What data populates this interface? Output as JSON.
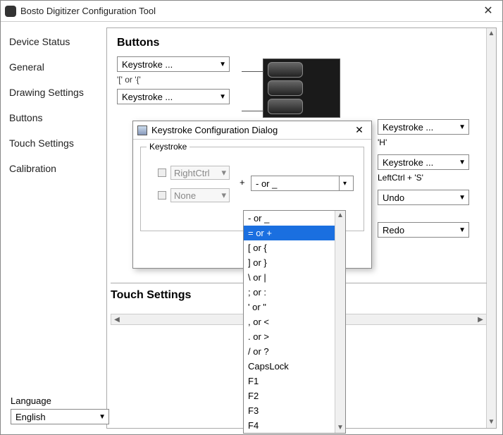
{
  "window": {
    "title": "Bosto Digitizer Configuration Tool"
  },
  "sidebar": {
    "items": [
      {
        "label": "Device Status"
      },
      {
        "label": "General"
      },
      {
        "label": "Drawing Settings"
      },
      {
        "label": "Buttons"
      },
      {
        "label": "Touch Settings"
      },
      {
        "label": "Calibration"
      }
    ]
  },
  "buttons_section": {
    "title": "Buttons",
    "combo1": "Keystroke ...",
    "caption1": "'[' or '{'",
    "combo2": "Keystroke ..."
  },
  "right_col": {
    "c1": "Keystroke ...",
    "c1_caption": "'H'",
    "c2": "Keystroke ...",
    "c2_caption": "LeftCtrl + 'S'",
    "c3": "Undo",
    "c4": "Redo"
  },
  "touch_section": {
    "title": "Touch Settings"
  },
  "language": {
    "label": "Language",
    "value": "English"
  },
  "dialog": {
    "title": "Keystroke Configuration Dialog",
    "legend": "Keystroke",
    "mod1": "RightCtrl",
    "mod2": "None",
    "plus": "+",
    "key_value": "- or _"
  },
  "dropdown": {
    "items": [
      "- or _",
      "= or +",
      "[ or {",
      "] or }",
      "\\ or |",
      "; or :",
      "' or \"",
      ", or <",
      ". or >",
      "/ or ?",
      "CapsLock",
      "F1",
      "F2",
      "F3",
      "F4"
    ],
    "selected_index": 1
  }
}
